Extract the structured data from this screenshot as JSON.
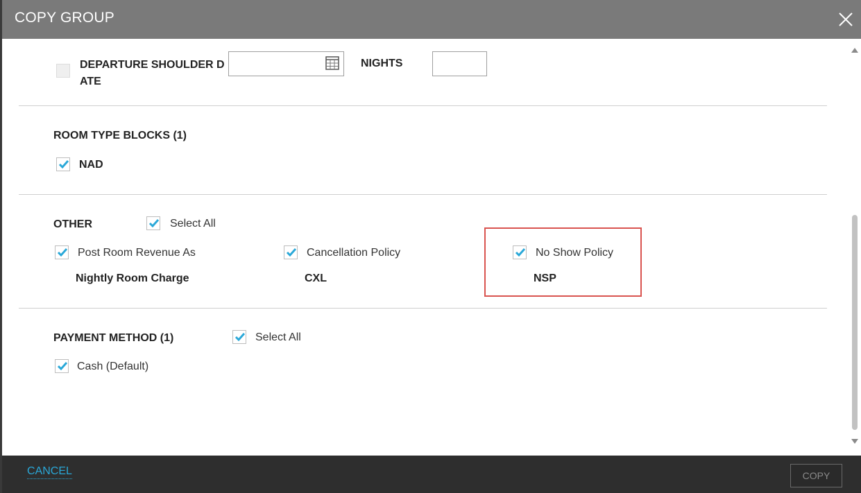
{
  "dialog": {
    "title": "COPY GROUP"
  },
  "departure": {
    "label": "DEPARTURE SHOULDER D ATE",
    "label_line1": "DEPARTURE SHOULDER D",
    "label_line2": "ATE",
    "date_value": "",
    "nights_label": "NIGHTS",
    "nights_value": ""
  },
  "room_type_blocks": {
    "heading": "ROOM TYPE BLOCKS (1)",
    "items": [
      {
        "label": "NAD",
        "checked": true
      }
    ]
  },
  "other": {
    "heading": "OTHER",
    "select_all": "Select All",
    "items": [
      {
        "label": "Post Room Revenue As",
        "value": "Nightly Room Charge",
        "checked": true
      },
      {
        "label": "Cancellation Policy",
        "value": "CXL",
        "checked": true
      },
      {
        "label": "No Show Policy",
        "value": "NSP",
        "checked": true
      }
    ]
  },
  "payment_method": {
    "heading": "PAYMENT METHOD (1)",
    "select_all": "Select All",
    "items": [
      {
        "label": "Cash (Default)",
        "checked": true
      }
    ]
  },
  "footer": {
    "cancel_label": "CANCEL",
    "copy_label": "COPY"
  },
  "colors": {
    "titlebar": "#7a7a7a",
    "footer": "#2e2e2e",
    "accent": "#2aa8d8",
    "highlight": "#d9534f"
  }
}
